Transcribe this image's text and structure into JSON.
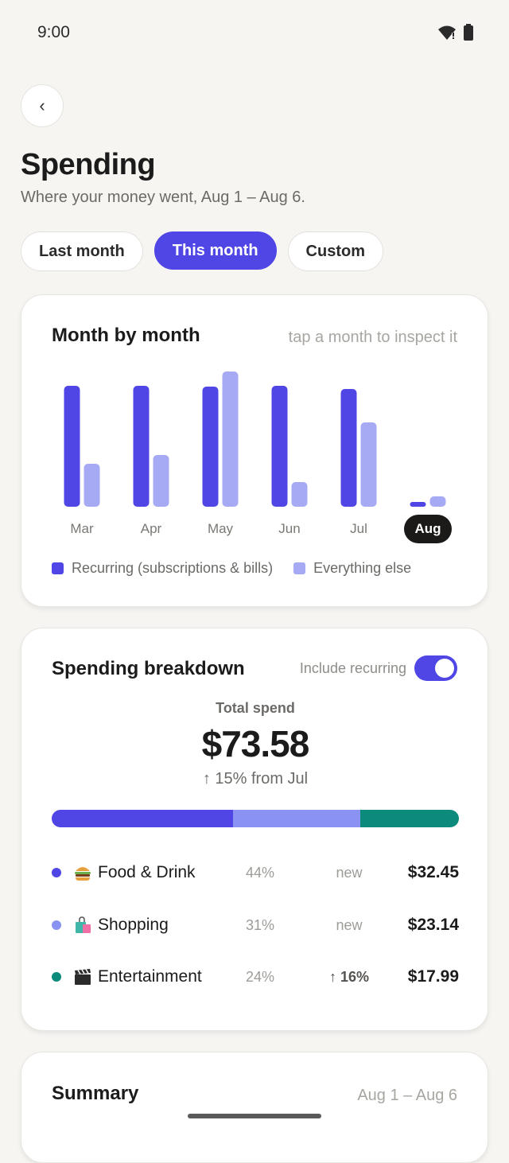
{
  "status_bar": {
    "time": "9:00",
    "wifi_icon": "wifi-icon",
    "battery_icon": "battery-icon"
  },
  "header": {
    "back_label": "‹",
    "title": "Spending",
    "subtitle": "Where your money went, Aug 1 – Aug 6."
  },
  "tabs": [
    {
      "label": "Last month",
      "active": false
    },
    {
      "label": "This month",
      "active": true
    },
    {
      "label": "Custom",
      "active": false
    }
  ],
  "month_card": {
    "title": "Month by month",
    "hint": "tap a month to inspect it",
    "legend": [
      {
        "label": "Recurring (subscriptions & bills)",
        "color": "#4f46e5"
      },
      {
        "label": "Everything else",
        "color": "#a6aaf4"
      }
    ]
  },
  "chart_data": {
    "type": "bar",
    "categories": [
      "Mar",
      "Apr",
      "May",
      "Jun",
      "Jul",
      "Aug"
    ],
    "selected": "Aug",
    "series": [
      {
        "name": "Recurring (subscriptions & bills)",
        "color": "#4f46e5",
        "values": [
          152,
          152,
          151,
          152,
          148,
          6
        ]
      },
      {
        "name": "Everything else",
        "color": "#a6aaf4",
        "values": [
          54,
          65,
          170,
          31,
          106,
          13
        ]
      }
    ],
    "ylim": [
      0,
      170
    ],
    "grid": false,
    "legend_position": "bottom-left"
  },
  "breakdown_card": {
    "title": "Spending breakdown",
    "toggle_label": "Include recurring",
    "toggle_on": true,
    "total_label": "Total spend",
    "total_amount": "$73.58",
    "total_change": "↑ 15% from Jul",
    "categories": [
      {
        "name": "Food & Drink",
        "emoji": "burger-icon",
        "pct": "44%",
        "change": "new",
        "amount": "$32.45",
        "color": "#4f46e5",
        "share": 0.44
      },
      {
        "name": "Shopping",
        "emoji": "shopping-bag-icon",
        "pct": "31%",
        "change": "new",
        "amount": "$23.14",
        "color": "#8b93f2",
        "share": 0.31
      },
      {
        "name": "Entertainment",
        "emoji": "clapperboard-icon",
        "pct": "24%",
        "change": "↑ 16%",
        "amount": "$17.99",
        "color": "#0c8a7c",
        "share": 0.24
      }
    ]
  },
  "summary_card": {
    "title": "Summary",
    "range": "Aug 1 – Aug 6"
  }
}
